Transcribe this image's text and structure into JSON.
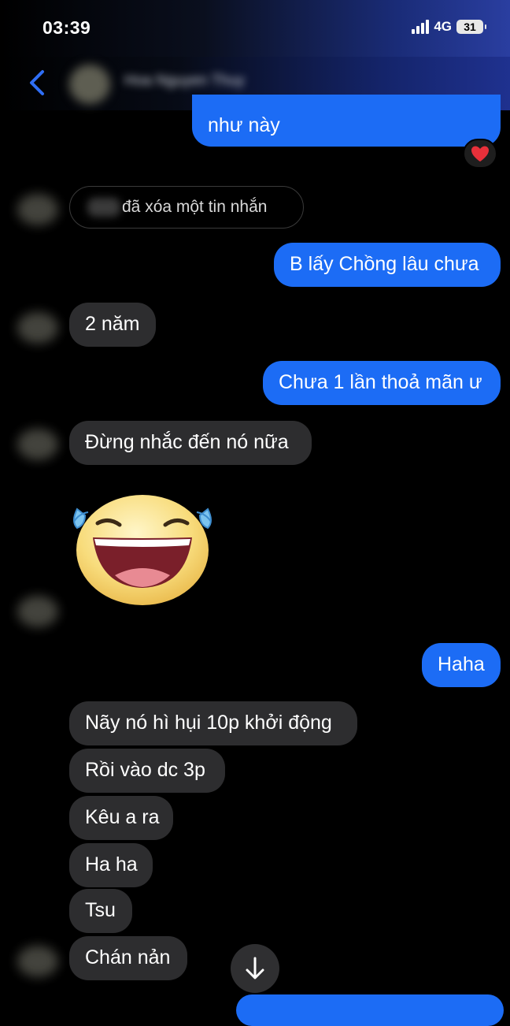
{
  "status": {
    "time": "03:39",
    "network": "4G",
    "battery": "31"
  },
  "header": {
    "contact_name": "Hoa Nguyen Thuy"
  },
  "messages": {
    "out_top": "như này",
    "deleted_notice": "đã xóa một tin nhắn",
    "out_1": "B lấy Chồng lâu chưa",
    "in_1": "2 năm",
    "out_2": "Chưa 1 lần thoả mãn ư",
    "in_2": "Đừng nhắc đến nó nữa",
    "out_3": "Haha",
    "in_3": "Nãy nó hì hụi 10p khởi động",
    "in_4": "Rồi vào dc 3p",
    "in_5": "Kêu a ra",
    "in_6": "Ha ha",
    "in_7": "Tsu",
    "in_8": "Chán nản"
  },
  "icons": {
    "back": "chevron-left-icon",
    "reaction": "heart-icon",
    "sticker": "laughing-tears-emoji-icon",
    "scroll": "arrow-down-icon"
  },
  "colors": {
    "outgoing": "#1c6cf5",
    "incoming": "#2d2d2f",
    "background": "#000000",
    "accent": "#2f6ef5"
  }
}
